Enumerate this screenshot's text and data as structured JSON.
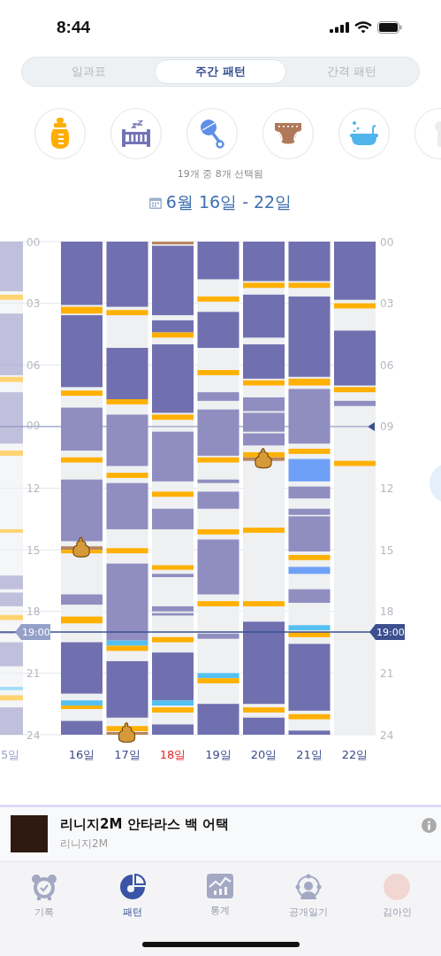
{
  "status_bar": {
    "time": "8:44"
  },
  "tabs": [
    {
      "label": "일과표",
      "selected": false
    },
    {
      "label": "주간 패턴",
      "selected": true
    },
    {
      "label": "간격 패턴",
      "selected": false
    }
  ],
  "categories": [
    {
      "kind": "feeding"
    },
    {
      "kind": "sleep"
    },
    {
      "kind": "play"
    },
    {
      "kind": "diaper"
    },
    {
      "kind": "bath"
    },
    {
      "kind": "more"
    }
  ],
  "selection_count": "19개 중 8개 선택됨",
  "date_range": "6월 16일 - 22일",
  "chart": {
    "left_hours": [
      "00",
      "03",
      "06",
      "09",
      "12",
      "15",
      "18",
      "21",
      "24"
    ],
    "right_hours": [
      "00",
      "03",
      "06",
      "09",
      "12",
      "15",
      "18",
      "21",
      "24"
    ],
    "now_line": {
      "left_label": "19:00",
      "right_label": "19:00"
    },
    "previous_day": {
      "label": "5일"
    },
    "days": [
      {
        "label": "16일",
        "holiday": false
      },
      {
        "label": "17일",
        "holiday": false
      },
      {
        "label": "18일",
        "holiday": true
      },
      {
        "label": "19일",
        "holiday": false
      },
      {
        "label": "20일",
        "holiday": false
      },
      {
        "label": "21일",
        "holiday": false
      },
      {
        "label": "22일",
        "holiday": false
      }
    ]
  },
  "ad_banner": {
    "title": "리니지2M 안타라스 백 어택",
    "subtitle": "리니지2M"
  },
  "bottom_nav": [
    {
      "kind": "record",
      "label": "기록",
      "selected": false
    },
    {
      "kind": "pattern",
      "label": "패턴",
      "selected": true
    },
    {
      "kind": "stats",
      "label": "통계",
      "selected": false
    },
    {
      "kind": "diary",
      "label": "공개일기",
      "selected": false
    },
    {
      "kind": "profile",
      "label": "김아인",
      "selected": false
    }
  ]
}
